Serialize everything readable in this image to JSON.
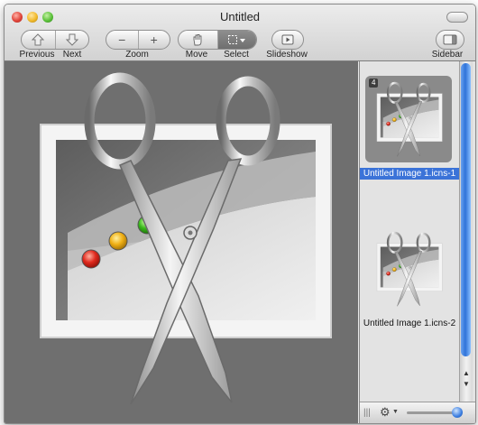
{
  "window": {
    "title": "Untitled"
  },
  "toolbar": {
    "previous_label": "Previous",
    "next_label": "Next",
    "zoom_label": "Zoom",
    "move_label": "Move",
    "select_label": "Select",
    "slideshow_label": "Slideshow",
    "sidebar_label": "Sidebar"
  },
  "sidebar": {
    "items": [
      {
        "label": "Untitled Image 1.icns-1",
        "badge": "4",
        "selected": true
      },
      {
        "label": "Untitled Image 1.icns-2",
        "selected": false
      }
    ],
    "thumbnail_size": 0.9
  },
  "icons": {
    "previous": "previous-arrow-icon",
    "next": "next-arrow-icon",
    "zoom_out": "minus-icon",
    "zoom_in": "plus-icon",
    "move": "hand-icon",
    "select": "selection-icon",
    "slideshow": "play-icon",
    "sidebar": "sidebar-icon",
    "action": "gear-icon"
  },
  "colors": {
    "selection": "#3b73d8",
    "content_bg": "#6f6f6f"
  }
}
